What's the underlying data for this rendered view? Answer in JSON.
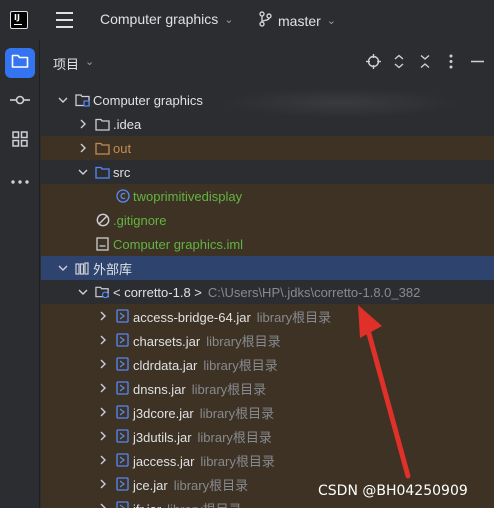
{
  "titlebar": {
    "logo_text": "IJ",
    "project_name": "Computer graphics",
    "branch_name": "master"
  },
  "panel": {
    "title": "项目"
  },
  "tree": [
    {
      "label": "Computer graphics",
      "suffix": "",
      "indent": 0,
      "arrow": "down",
      "icon": "project-folder-icon",
      "color": "#dfe1e5"
    },
    {
      "label": ".idea",
      "suffix": "",
      "indent": 1,
      "arrow": "right",
      "icon": "folder-icon",
      "color": "#dfe1e5"
    },
    {
      "label": "out",
      "suffix": "",
      "indent": 1,
      "arrow": "right",
      "icon": "excluded-folder-icon",
      "color": "#c48b54"
    },
    {
      "label": "src",
      "suffix": "",
      "indent": 1,
      "arrow": "down",
      "icon": "source-folder-icon",
      "color": "#dfe1e5"
    },
    {
      "label": "twoprimitivedisplay",
      "suffix": "",
      "indent": 2,
      "arrow": "",
      "icon": "class-icon",
      "color": "#62b543"
    },
    {
      "label": ".gitignore",
      "suffix": "",
      "indent": 1,
      "arrow": "",
      "icon": "ignore-file-icon",
      "color": "#62b543"
    },
    {
      "label": "Computer graphics.iml",
      "suffix": "",
      "indent": 1,
      "arrow": "",
      "icon": "iml-file-icon",
      "color": "#62b543"
    },
    {
      "label": "外部库",
      "suffix": "",
      "indent": 0,
      "arrow": "down",
      "icon": "library-icon",
      "color": "#dfe1e5"
    },
    {
      "label": "< corretto-1.8 >",
      "suffix": "C:\\Users\\HP\\.jdks\\corretto-1.8.0_382",
      "indent": 1,
      "arrow": "down",
      "icon": "jdk-folder-icon",
      "color": "#dfe1e5"
    },
    {
      "label": "access-bridge-64.jar",
      "suffix": "library根目录",
      "indent": 2,
      "arrow": "right",
      "icon": "jar-icon",
      "color": "#dfe1e5"
    },
    {
      "label": "charsets.jar",
      "suffix": "library根目录",
      "indent": 2,
      "arrow": "right",
      "icon": "jar-icon",
      "color": "#dfe1e5"
    },
    {
      "label": "cldrdata.jar",
      "suffix": "library根目录",
      "indent": 2,
      "arrow": "right",
      "icon": "jar-icon",
      "color": "#dfe1e5"
    },
    {
      "label": "dnsns.jar",
      "suffix": "library根目录",
      "indent": 2,
      "arrow": "right",
      "icon": "jar-icon",
      "color": "#dfe1e5"
    },
    {
      "label": "j3dcore.jar",
      "suffix": "library根目录",
      "indent": 2,
      "arrow": "right",
      "icon": "jar-icon",
      "color": "#dfe1e5"
    },
    {
      "label": "j3dutils.jar",
      "suffix": "library根目录",
      "indent": 2,
      "arrow": "right",
      "icon": "jar-icon",
      "color": "#dfe1e5"
    },
    {
      "label": "jaccess.jar",
      "suffix": "library根目录",
      "indent": 2,
      "arrow": "right",
      "icon": "jar-icon",
      "color": "#dfe1e5"
    },
    {
      "label": "jce.jar",
      "suffix": "library根目录",
      "indent": 2,
      "arrow": "right",
      "icon": "jar-icon",
      "color": "#dfe1e5"
    },
    {
      "label": "jfr.jar",
      "suffix": "library根目录",
      "indent": 2,
      "arrow": "right",
      "icon": "jar-icon",
      "color": "#dfe1e5"
    }
  ],
  "watermark": "CSDN @BH04250909",
  "colors": {
    "accent": "#3574f0",
    "selection": "#2e436e",
    "excluded_bg": "#3d3223",
    "annotation_arrow": "#e0302a"
  }
}
